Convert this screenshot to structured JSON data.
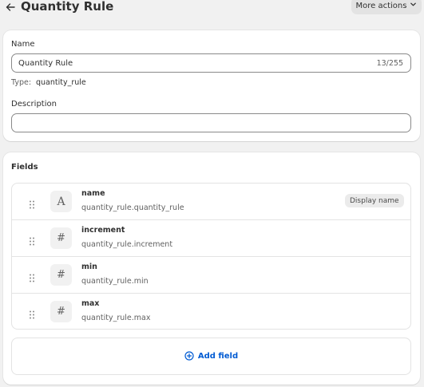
{
  "header": {
    "title": "Quantity Rule",
    "more_actions_label": "More actions",
    "back_icon": "arrow-left-icon",
    "more_actions_icon": "chevron-down-icon"
  },
  "general": {
    "name_label": "Name",
    "name_value": "Quantity Rule",
    "name_counter": "13/255",
    "type_label": "Type:",
    "type_value": "quantity_rule",
    "description_label": "Description",
    "description_value": ""
  },
  "fields_section": {
    "title": "Fields",
    "items": [
      {
        "name": "name",
        "key": "quantity_rule.quantity_rule",
        "type_icon": "A",
        "badge": "Display name"
      },
      {
        "name": "increment",
        "key": "quantity_rule.increment",
        "type_icon": "#"
      },
      {
        "name": "min",
        "key": "quantity_rule.min",
        "type_icon": "#"
      },
      {
        "name": "max",
        "key": "quantity_rule.max",
        "type_icon": "#"
      }
    ],
    "add_field_label": "Add field",
    "add_field_icon": "plus-circle-icon"
  },
  "colors": {
    "background": "#f1f1f1",
    "card": "#ffffff",
    "link": "#005bd3",
    "text": "#303030",
    "muted": "#616161"
  }
}
